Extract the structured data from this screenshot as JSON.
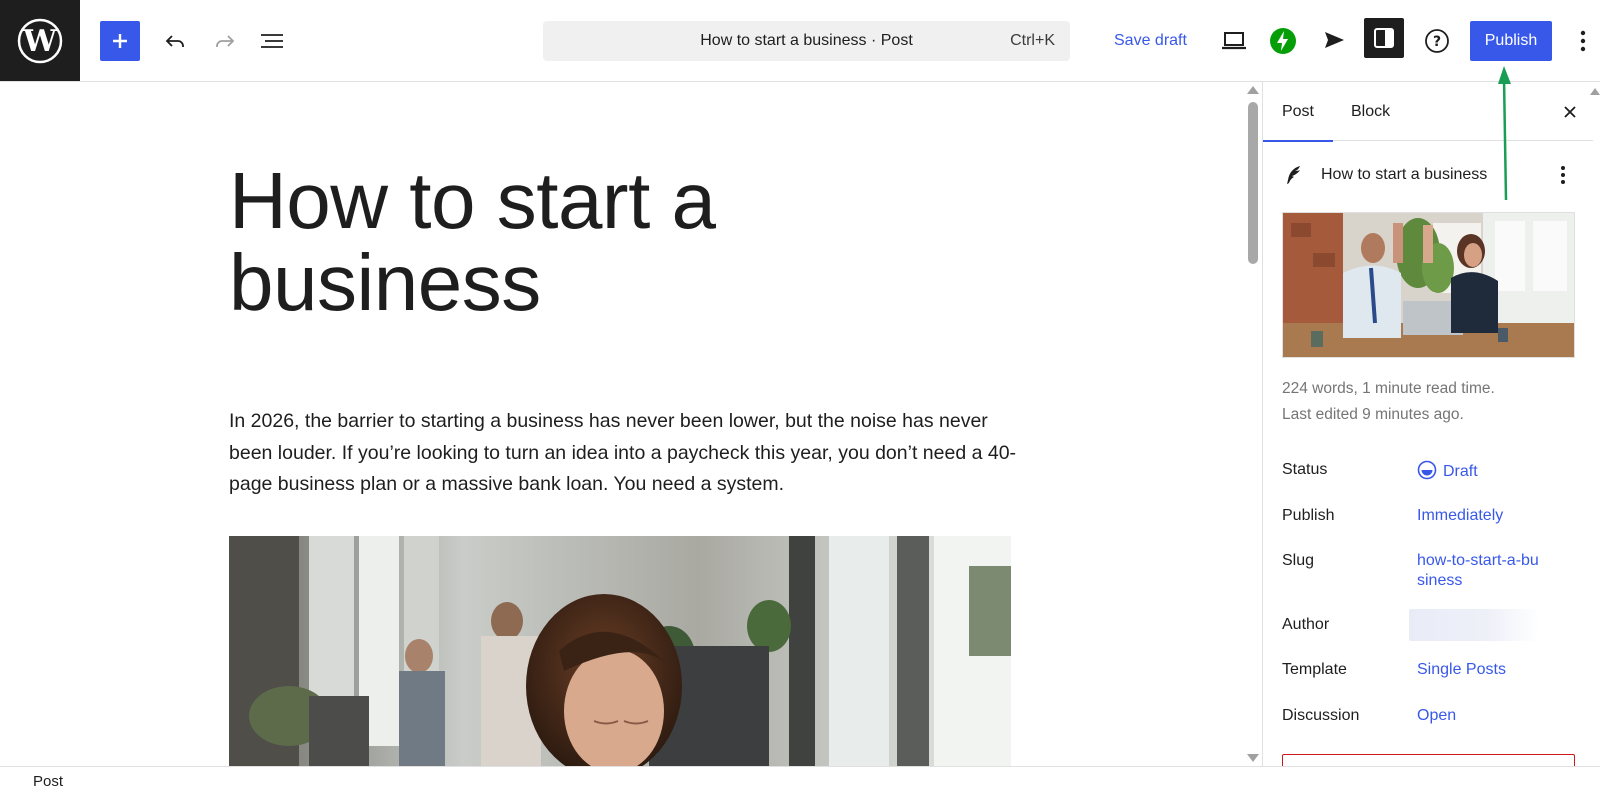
{
  "toolbar": {
    "command_title": "How to start a business · Post",
    "command_shortcut": "Ctrl+K",
    "save_draft": "Save draft",
    "publish": "Publish",
    "icons": [
      "wordpress-logo",
      "plus-icon",
      "undo-icon",
      "redo-icon",
      "document-overview-icon",
      "preview-laptop-icon",
      "jetpack-icon",
      "send-icon",
      "settings-sidebar-icon",
      "help-icon",
      "more-vertical-icon"
    ],
    "accent": "#3858e9"
  },
  "editor": {
    "title": "How to start a business",
    "paragraph": "In 2026, the barrier to starting a business has never been lower, but the noise has never been louder. If you’re looking to turn an idea into a paycheck this year, you don’t need a 40-page business plan or a massive bank loan. You need a system."
  },
  "sidebar": {
    "tabs": [
      "Post",
      "Block"
    ],
    "post_title": "How to start a business",
    "word_count": "224 words, 1 minute read time.",
    "last_edited": "Last edited 9 minutes ago.",
    "rows": {
      "status": {
        "label": "Status",
        "value": "Draft"
      },
      "publish": {
        "label": "Publish",
        "value": "Immediately"
      },
      "slug": {
        "label": "Slug",
        "value": "how-to-start-a-business"
      },
      "author": {
        "label": "Author",
        "value": ""
      },
      "template": {
        "label": "Template",
        "value": "Single Posts"
      },
      "discussion": {
        "label": "Discussion",
        "value": "Open"
      }
    }
  },
  "footer": {
    "breadcrumb": "Post"
  }
}
